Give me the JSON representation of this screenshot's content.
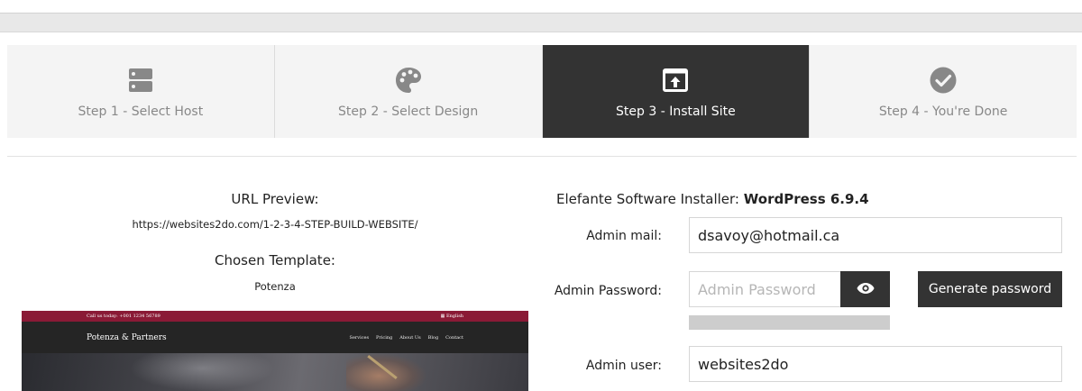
{
  "steps": [
    {
      "label": "Step 1 - Select Host",
      "icon": "server-icon"
    },
    {
      "label": "Step 2 - Select Design",
      "icon": "palette-icon"
    },
    {
      "label": "Step 3 - Install Site",
      "icon": "install-icon",
      "active": true
    },
    {
      "label": "Step 4 - You're Done",
      "icon": "check-circle-icon"
    }
  ],
  "preview_panel": {
    "url_title": "URL Preview:",
    "url_value": "https://websites2do.com/1-2-3-4-STEP-BUILD-WEBSITE/",
    "template_title": "Chosen Template:",
    "template_value": "Potenza",
    "thumbnail": {
      "call_text": "Call us today: +001 1234 56789",
      "language": "English",
      "logo": "Potenza & Partners",
      "menu": [
        "Services",
        "Pricing",
        "About Us",
        "Blog",
        "Contact"
      ]
    }
  },
  "installer": {
    "prefix": "Elefante Software Installer:",
    "product": "WordPress 6.9.4",
    "admin_mail_label": "Admin mail:",
    "admin_mail_value": "dsavoy@hotmail.ca",
    "admin_password_label": "Admin Password:",
    "admin_password_placeholder": "Admin Password",
    "generate_label": "Generate password",
    "admin_user_label": "Admin user:",
    "admin_user_value": "websites2do"
  },
  "colors": {
    "active_step": "#333333",
    "inactive_step": "#f4f4f4",
    "icon_gray": "#888888",
    "brand_bar": "#8a1a36"
  }
}
